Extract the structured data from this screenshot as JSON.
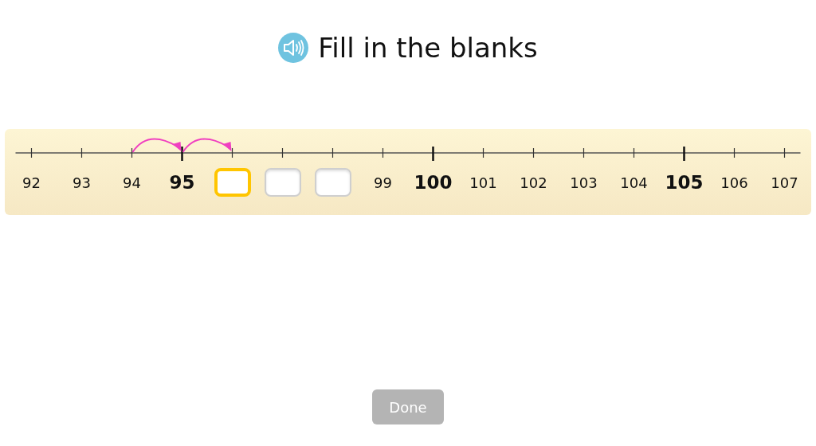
{
  "title": "Fill in the blanks",
  "number_line": {
    "marks": [
      {
        "kind": "number",
        "label": "92",
        "emphasized": false,
        "arrow_in": false
      },
      {
        "kind": "number",
        "label": "93",
        "emphasized": false,
        "arrow_in": false
      },
      {
        "kind": "number",
        "label": "94",
        "emphasized": false,
        "arrow_in": false
      },
      {
        "kind": "number",
        "label": "95",
        "emphasized": true,
        "arrow_in": true
      },
      {
        "kind": "blank",
        "selected": true,
        "arrow_in": true
      },
      {
        "kind": "blank",
        "selected": false,
        "arrow_in": false
      },
      {
        "kind": "blank",
        "selected": false,
        "arrow_in": false
      },
      {
        "kind": "number",
        "label": "99",
        "emphasized": false,
        "arrow_in": false
      },
      {
        "kind": "number",
        "label": "100",
        "emphasized": true,
        "arrow_in": false
      },
      {
        "kind": "number",
        "label": "101",
        "emphasized": false,
        "arrow_in": false
      },
      {
        "kind": "number",
        "label": "102",
        "emphasized": false,
        "arrow_in": false
      },
      {
        "kind": "number",
        "label": "103",
        "emphasized": false,
        "arrow_in": false
      },
      {
        "kind": "number",
        "label": "104",
        "emphasized": false,
        "arrow_in": false
      },
      {
        "kind": "number",
        "label": "105",
        "emphasized": true,
        "arrow_in": false
      },
      {
        "kind": "number",
        "label": "106",
        "emphasized": false,
        "arrow_in": false
      },
      {
        "kind": "number",
        "label": "107",
        "emphasized": false,
        "arrow_in": false
      }
    ]
  },
  "done_button": {
    "label": "Done",
    "disabled": true
  }
}
